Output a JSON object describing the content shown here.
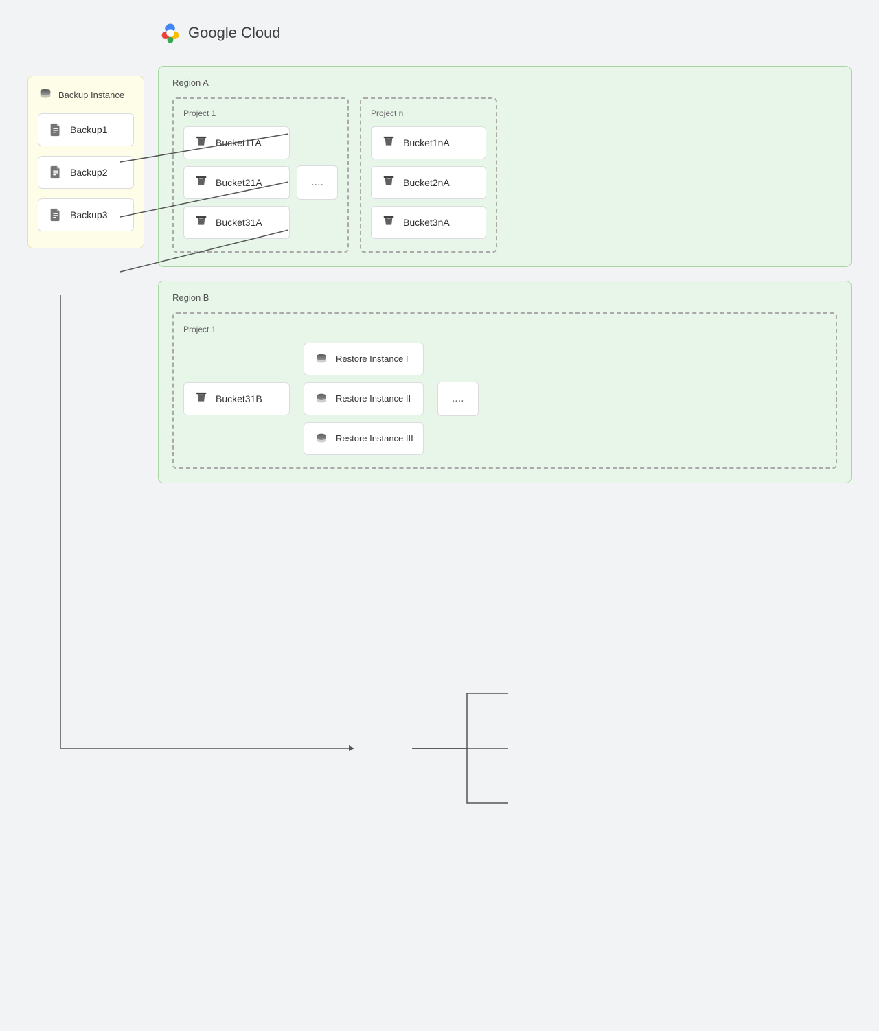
{
  "header": {
    "logo_alt": "Google Cloud logo",
    "title": "Google Cloud"
  },
  "backup_panel": {
    "header_label": "Backup Instance",
    "items": [
      {
        "id": "backup1",
        "label": "Backup1"
      },
      {
        "id": "backup2",
        "label": "Backup2"
      },
      {
        "id": "backup3",
        "label": "Backup3"
      }
    ]
  },
  "region_a": {
    "label": "Region A",
    "project1": {
      "label": "Project 1",
      "buckets": [
        {
          "id": "bucket11a",
          "label": "Bucket11A"
        },
        {
          "id": "bucket21a",
          "label": "Bucket21A"
        },
        {
          "id": "bucket31a",
          "label": "Bucket31A"
        }
      ],
      "ellipsis": "...."
    },
    "project_n": {
      "label": "Project n",
      "buckets": [
        {
          "id": "bucket1na",
          "label": "Bucket1nA"
        },
        {
          "id": "bucket2na",
          "label": "Bucket2nA"
        },
        {
          "id": "bucket3na",
          "label": "Bucket3nA"
        }
      ]
    }
  },
  "region_b": {
    "label": "Region B",
    "project1": {
      "label": "Project 1",
      "bucket": {
        "id": "bucket31b",
        "label": "Bucket31B"
      },
      "restore_instances": [
        {
          "id": "restore_i",
          "label": "Restore Instance I"
        },
        {
          "id": "restore_ii",
          "label": "Restore Instance II"
        },
        {
          "id": "restore_iii",
          "label": "Restore Instance III"
        }
      ],
      "ellipsis": "...."
    }
  },
  "icons": {
    "document": "document-icon",
    "bucket": "bucket-icon",
    "database": "database-icon",
    "backup_db": "backup-db-icon"
  }
}
